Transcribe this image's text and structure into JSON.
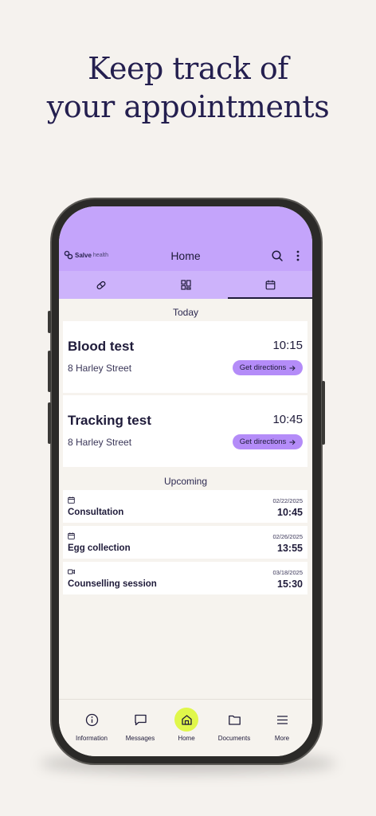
{
  "headline": {
    "line1": "Keep track of",
    "line2": "your appointments"
  },
  "app": {
    "logo_name": "Salve",
    "logo_sub": "health",
    "title": "Home"
  },
  "tabs": [
    {
      "icon": "pill-icon",
      "active": false
    },
    {
      "icon": "dashboard-icon",
      "active": false
    },
    {
      "icon": "calendar-icon",
      "active": true
    }
  ],
  "today": {
    "label": "Today",
    "appointments": [
      {
        "title": "Blood test",
        "time": "10:15",
        "address": "8 Harley Street",
        "button": "Get directions"
      },
      {
        "title": "Tracking test",
        "time": "10:45",
        "address": "8 Harley Street",
        "button": "Get directions"
      }
    ]
  },
  "upcoming": {
    "label": "Upcoming",
    "items": [
      {
        "icon": "calendar-icon",
        "title": "Consultation",
        "date": "02/22/2025",
        "time": "10:45"
      },
      {
        "icon": "calendar-icon",
        "title": "Egg collection",
        "date": "02/26/2025",
        "time": "13:55"
      },
      {
        "icon": "video-icon",
        "title": "Counselling session",
        "date": "03/18/2025",
        "time": "15:30"
      }
    ]
  },
  "nav": [
    {
      "label": "Information",
      "icon": "info-icon",
      "active": false
    },
    {
      "label": "Messages",
      "icon": "message-icon",
      "active": false
    },
    {
      "label": "Home",
      "icon": "home-icon",
      "active": true
    },
    {
      "label": "Documents",
      "icon": "folder-icon",
      "active": false
    },
    {
      "label": "More",
      "icon": "menu-icon",
      "active": false
    }
  ],
  "colors": {
    "background": "#f5f2ee",
    "appbar": "#c4a4fb",
    "tabbar": "#cdb3fb",
    "button": "#b48cf8",
    "nav_active": "#e0f74a",
    "text": "#1f1b3a"
  }
}
